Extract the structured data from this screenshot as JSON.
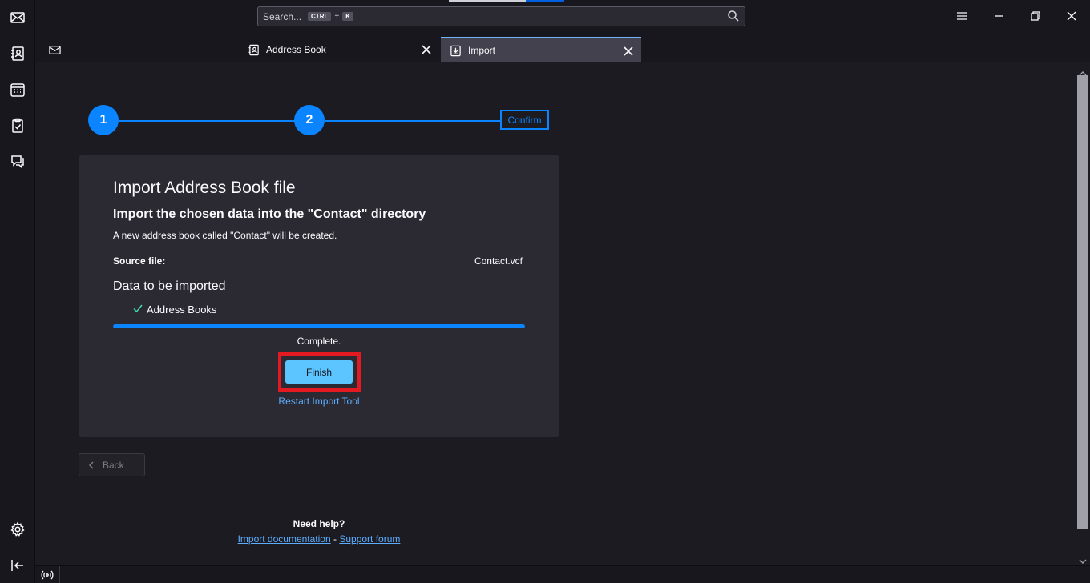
{
  "search": {
    "placeholder": "Search...",
    "key1": "CTRL",
    "plus": "+",
    "key2": "K"
  },
  "tabs": [
    {
      "label": "",
      "icon": "addressbook-tab-icon"
    },
    {
      "label": "Address Book",
      "icon": "addressbook-icon"
    },
    {
      "label": "Import",
      "icon": "import-icon",
      "active": true
    }
  ],
  "stepper": {
    "step1": "1",
    "step2": "2",
    "step3": "Confirm"
  },
  "card": {
    "title": "Import Address Book file",
    "subtitle": "Import the chosen data into the \"Contact\" directory",
    "description": "A new address book called \"Contact\" will be created.",
    "source_label": "Source file:",
    "source_value": "Contact.vcf",
    "data_heading": "Data to be imported",
    "items": [
      "Address Books"
    ],
    "progress": 1.0,
    "status": "Complete.",
    "finish_label": "Finish",
    "restart_label": "Restart Import Tool"
  },
  "back_label": "Back",
  "help": {
    "title": "Need help?",
    "doc_link": "Import documentation",
    "separator": "-",
    "forum_link": "Support forum"
  },
  "colors": {
    "accent": "#0a84ff",
    "highlight": "#e31a22",
    "check": "#3fe1b0"
  }
}
